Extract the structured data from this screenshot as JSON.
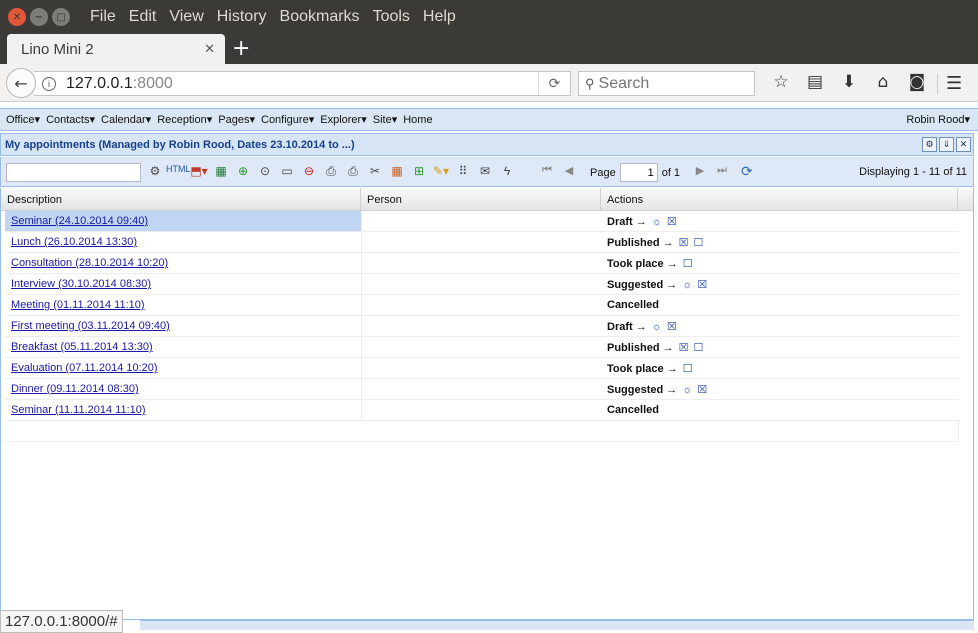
{
  "browser": {
    "menus": [
      "File",
      "Edit",
      "View",
      "History",
      "Bookmarks",
      "Tools",
      "Help"
    ],
    "tab_title": "Lino Mini 2",
    "url_host": "127.0.0.1",
    "url_port": ":8000",
    "search_placeholder": "Search",
    "status_url": "127.0.0.1:8000/#"
  },
  "appmenu": {
    "items": [
      "Office",
      "Contacts",
      "Calendar",
      "Reception",
      "Pages",
      "Configure",
      "Explorer",
      "Site",
      "Home"
    ],
    "user": "Robin Rood"
  },
  "panel": {
    "title": "My appointments (Managed by Robin Rood, Dates 23.10.2014 to ...)"
  },
  "toolbar": {
    "page_label": "Page",
    "page_value": "1",
    "page_of": "of 1",
    "displaying": "Displaying 1 - 11 of 11"
  },
  "grid": {
    "columns": [
      "Description",
      "Person",
      "Actions"
    ],
    "rows": [
      {
        "description": "Seminar (24.10.2014 09:40)",
        "person": "",
        "state": "Draft →",
        "actions": [
          "☼",
          "☒"
        ]
      },
      {
        "description": "Lunch (26.10.2014 13:30)",
        "person": "",
        "state": "Published →",
        "actions": [
          "☒",
          "☐"
        ]
      },
      {
        "description": "Consultation (28.10.2014 10:20)",
        "person": "",
        "state": "Took place →",
        "actions": [
          "☐"
        ]
      },
      {
        "description": "Interview (30.10.2014 08:30)",
        "person": "",
        "state": "Suggested →",
        "actions": [
          "☼",
          "☒"
        ]
      },
      {
        "description": "Meeting (01.11.2014 11:10)",
        "person": "",
        "state": "Cancelled",
        "actions": []
      },
      {
        "description": "First meeting (03.11.2014 09:40)",
        "person": "",
        "state": "Draft →",
        "actions": [
          "☼",
          "☒"
        ]
      },
      {
        "description": "Breakfast (05.11.2014 13:30)",
        "person": "",
        "state": "Published →",
        "actions": [
          "☒",
          "☐"
        ]
      },
      {
        "description": "Evaluation (07.11.2014 10:20)",
        "person": "",
        "state": "Took place →",
        "actions": [
          "☐"
        ]
      },
      {
        "description": "Dinner (09.11.2014 08:30)",
        "person": "",
        "state": "Suggested →",
        "actions": [
          "☼",
          "☒"
        ]
      },
      {
        "description": "Seminar (11.11.2014 11:10)",
        "person": "",
        "state": "Cancelled",
        "actions": []
      }
    ]
  }
}
